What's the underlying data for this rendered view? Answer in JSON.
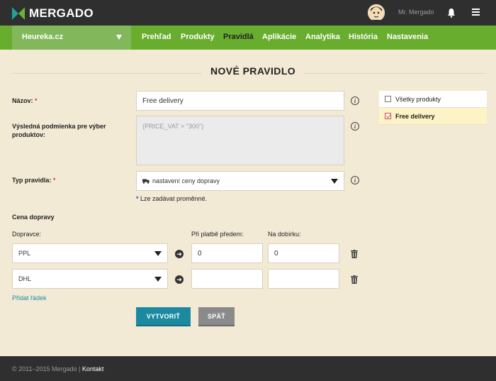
{
  "header": {
    "logo_text": "MERGADO",
    "username": "Mr. Mergado"
  },
  "nav": {
    "shop": "Heureka.cz",
    "items": [
      {
        "label": "Prehľad"
      },
      {
        "label": "Produkty"
      },
      {
        "label": "Pravidlá",
        "active": true
      },
      {
        "label": "Aplikácie"
      },
      {
        "label": "Analytika"
      },
      {
        "label": "História"
      },
      {
        "label": "Nastavenia"
      }
    ]
  },
  "page": {
    "title": "NOVÉ PRAVIDLO"
  },
  "form": {
    "name_label": "Názov:",
    "required_mark": "*",
    "name_value": "Free delivery",
    "condition_label": "Výsledná podmienka pre výber produktov:",
    "condition_placeholder": "(PRICE_VAT > \"300\")",
    "rule_type_label": "Typ pravidla:",
    "rule_type_value": "nastavení ceny dopravy",
    "variables_hint_star": "*",
    "variables_hint": "Lze zadávat proměnné.",
    "shipping_price_label": "Cena dopravy",
    "carrier_label": "Dopravce:",
    "prepay_label": "Při platbě předem:",
    "cod_label": "Na dobírku:",
    "rows": [
      {
        "carrier": "PPL",
        "prepay": "0",
        "cod": "0"
      },
      {
        "carrier": "DHL",
        "prepay": "",
        "cod": ""
      }
    ],
    "add_row_link": "Přidat řádek",
    "create_button": "VYTVORIŤ",
    "back_button": "SPÄŤ"
  },
  "side_panel": {
    "items": [
      {
        "label": "Všetky produkty",
        "checked": false
      },
      {
        "label": "Free delivery",
        "checked": true
      }
    ]
  },
  "footer": {
    "copyright": "© 2011–2015 Mergado |",
    "contact": "Kontakt"
  },
  "colors": {
    "topbar": "#2f2f2f",
    "navbar": "#69ad2f",
    "background": "#f3ead6",
    "primary_button": "#1b8aa0",
    "secondary_button": "#8a8a8a"
  }
}
